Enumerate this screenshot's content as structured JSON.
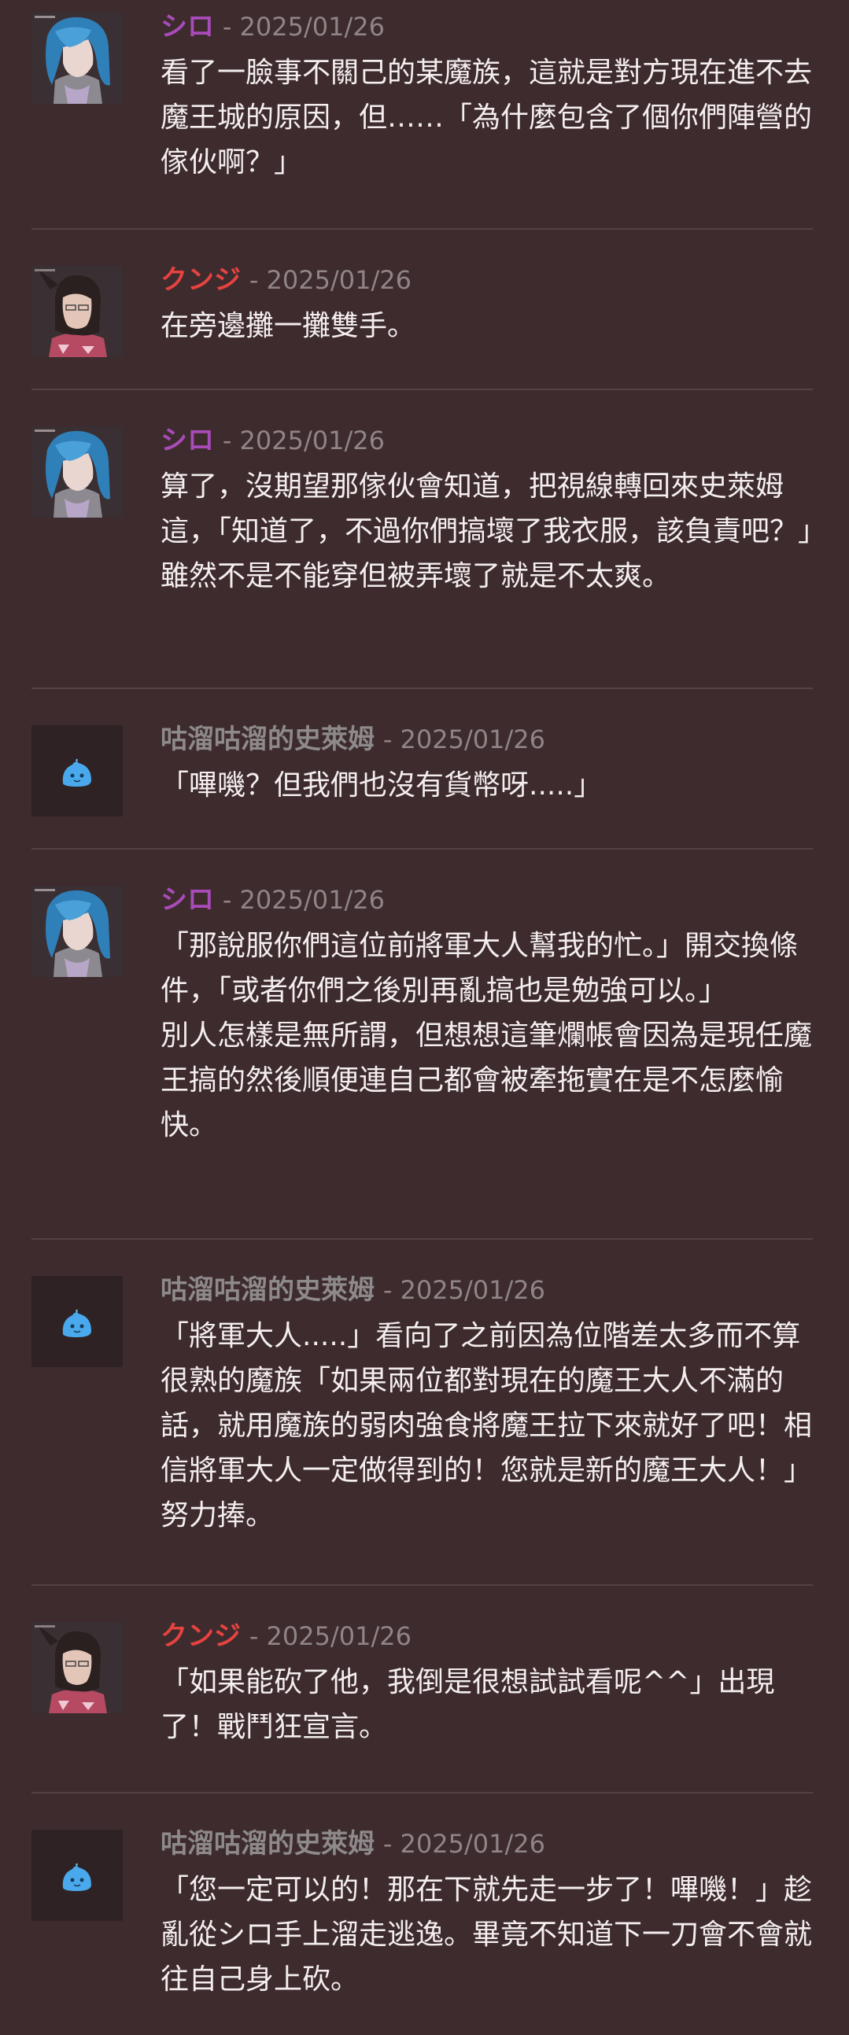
{
  "colors": {
    "background": "#3d2b2e",
    "divider": "#544245",
    "date": "#8f8487",
    "shiro": "#a94bb8",
    "kunji": "#e5433f",
    "slime": "#8e8a8b"
  },
  "posts": [
    {
      "author": "シロ",
      "author_key": "shiro",
      "avatar": "blue-haired-character-avatar",
      "date": "- 2025/01/26",
      "paragraphs": [
        "看了一臉事不關己的某魔族，這就是對方現在進不去魔王城的原因，但……「為什麼包含了個你們陣營的傢伙啊？」"
      ]
    },
    {
      "author": "クンジ",
      "author_key": "kunji",
      "avatar": "horned-character-avatar",
      "date": "- 2025/01/26",
      "paragraphs": [
        "在旁邊攤一攤雙手。"
      ]
    },
    {
      "author": "シロ",
      "author_key": "shiro",
      "avatar": "blue-haired-character-avatar",
      "date": "- 2025/01/26",
      "paragraphs": [
        "算了，沒期望那傢伙會知道，把視線轉回來史萊姆這，「知道了，不過你們搞壞了我衣服，該負責吧？」",
        "雖然不是不能穿但被弄壞了就是不太爽。"
      ]
    },
    {
      "author": "咕溜咕溜的史萊姆",
      "author_key": "slime",
      "avatar": "slime-avatar",
      "date": "- 2025/01/26",
      "paragraphs": [
        "「嗶嘰？但我們也沒有貨幣呀.....」"
      ]
    },
    {
      "author": "シロ",
      "author_key": "shiro",
      "avatar": "blue-haired-character-avatar",
      "date": "- 2025/01/26",
      "paragraphs": [
        "「那說服你們這位前將軍大人幫我的忙。」開交換條件，「或者你們之後別再亂搞也是勉強可以。」",
        "別人怎樣是無所謂，但想想這筆爛帳會因為是現任魔王搞的然後順便連自己都會被牽拖實在是不怎麼愉快。"
      ]
    },
    {
      "author": "咕溜咕溜的史萊姆",
      "author_key": "slime",
      "avatar": "slime-avatar",
      "date": "- 2025/01/26",
      "paragraphs": [
        "「將軍大人.....」看向了之前因為位階差太多而不算很熟的魔族「如果兩位都對現在的魔王大人不滿的話，就用魔族的弱肉強食將魔王拉下來就好了吧！相信將軍大人一定做得到的！您就是新的魔王大人！」努力捧。"
      ]
    },
    {
      "author": "クンジ",
      "author_key": "kunji",
      "avatar": "horned-character-avatar",
      "date": "- 2025/01/26",
      "paragraphs": [
        "「如果能砍了他，我倒是很想試試看呢^^」出現了！戰鬥狂宣言。"
      ]
    },
    {
      "author": "咕溜咕溜的史萊姆",
      "author_key": "slime",
      "avatar": "slime-avatar",
      "date": "- 2025/01/26",
      "paragraphs": [
        "「您一定可以的！那在下就先走一步了！嗶嘰！」趁亂從シロ手上溜走逃逸。畢竟不知道下一刀會不會就往自己身上砍。"
      ]
    }
  ]
}
